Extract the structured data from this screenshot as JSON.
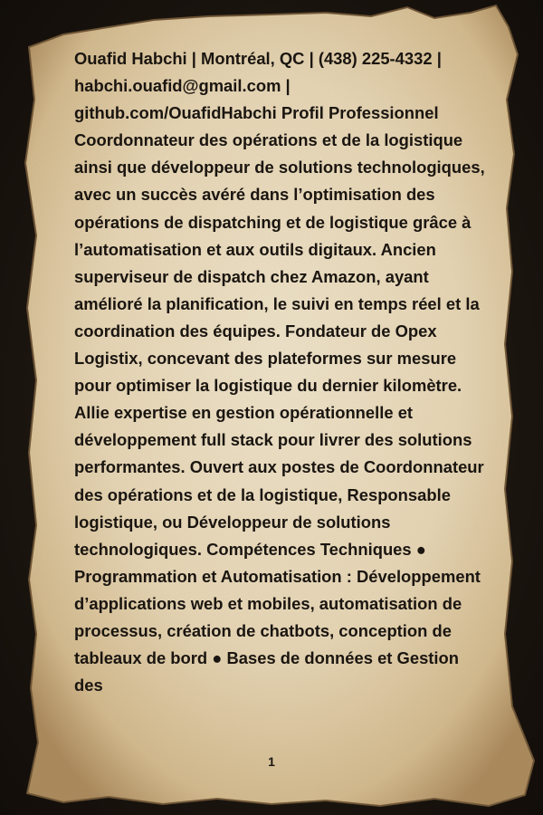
{
  "document": {
    "body_text": "Ouafid Habchi | Montréal, QC | (438) 225-4332 | habchi.ouafid@gmail.com | github.com/OuafidHabchi Profil Professionnel Coordonnateur des opérations et de la logistique ainsi que développeur de solutions technologiques, avec un succès avéré dans l’optimisation des opérations de dispatching et de logistique grâce à l’automatisation et aux outils digitaux. Ancien superviseur de dispatch chez Amazon, ayant amélioré la planification, le suivi en temps réel et la coordination des équipes. Fondateur de Opex Logistix, concevant des plateformes sur mesure pour optimiser la logistique du dernier kilomètre. Allie expertise en gestion opérationnelle et développement full stack pour livrer des solutions performantes. Ouvert aux postes de Coordonnateur des opérations et de la logistique, Responsable logistique, ou Développeur de solutions technologiques. Compétences Techniques ● Programmation et Automatisation : Développement d’applications web et mobiles, automatisation de processus, création de chatbots, conception de tableaux de bord ● Bases de données et Gestion des",
    "page_number": "1"
  },
  "colors": {
    "paper": "#e9dcc1",
    "paper_edge": "#b99a6a",
    "ink": "#1a1510",
    "background": "#1b1510"
  }
}
